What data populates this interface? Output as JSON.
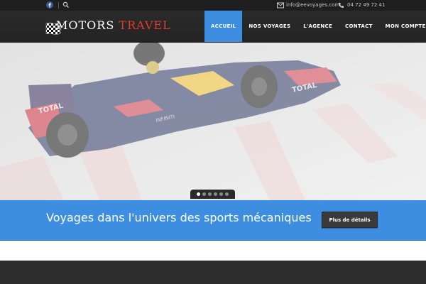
{
  "topbar": {
    "email": "info@eevoyages.com",
    "phone": "04 72 49 72 41"
  },
  "logo": {
    "word1": "MOTORS",
    "word2": "TRAVEL"
  },
  "nav": {
    "items": [
      {
        "label": "ACCUEIL"
      },
      {
        "label": "NOS VOYAGES"
      },
      {
        "label": "L'AGENCE"
      },
      {
        "label": "CONTACT"
      },
      {
        "label": "MON COMPTE"
      }
    ],
    "active_index": 0
  },
  "hero": {
    "car_text": "TOTAL",
    "car_text2": "INFINITI",
    "slides_count": 6,
    "active_slide": 0
  },
  "banner": {
    "tagline": "Voyages dans l'univers des sports mécaniques",
    "button_label": "Plus de détails"
  },
  "colors": {
    "accent": "#3d8ee0",
    "topbar": "#1e1e1e",
    "header": "#2b2b2b",
    "logo_red": "#e03a2c",
    "footer": "#2d2d2d"
  }
}
